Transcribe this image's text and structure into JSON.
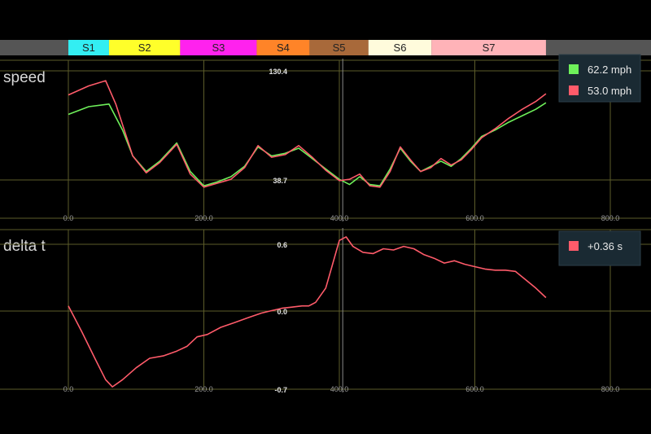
{
  "sectors": [
    {
      "label": "S1",
      "color": "#33eef2",
      "from": 0,
      "to": 60
    },
    {
      "label": "S2",
      "color": "#ffff2a",
      "from": 60,
      "to": 165
    },
    {
      "label": "S3",
      "color": "#ff22ee",
      "from": 165,
      "to": 278
    },
    {
      "label": "S4",
      "color": "#ff8428",
      "from": 278,
      "to": 356
    },
    {
      "label": "S5",
      "color": "#a8693a",
      "from": 356,
      "to": 443
    },
    {
      "label": "S6",
      "color": "#fffbdc",
      "from": 443,
      "to": 536
    },
    {
      "label": "S7",
      "color": "#ffb3b8",
      "from": 536,
      "to": 705
    }
  ],
  "colors": {
    "lap_a": "#6ef05a",
    "lap_b": "#ff5b6a",
    "grid": "#5c5c2a",
    "cursor": "#8a8a8a",
    "sector_bar_bg": "#555555",
    "legend_bg": "#1a2a33"
  },
  "chart_data": [
    {
      "type": "line",
      "title": "speed",
      "xlim": [
        0,
        800
      ],
      "x_ticks": [
        "0.0",
        "200.0",
        "400.0",
        "600.0",
        "800.0"
      ],
      "y_labels": [
        "130.4",
        "38.7"
      ],
      "ylim": [
        22,
        140
      ],
      "cursor_x": 405,
      "grid": true,
      "legend_position": "top-right",
      "series": [
        {
          "name": "62.2 mph",
          "color": "#6ef05a",
          "x": [
            0,
            30,
            60,
            80,
            95,
            115,
            135,
            160,
            180,
            200,
            220,
            240,
            260,
            280,
            300,
            320,
            340,
            360,
            380,
            400,
            415,
            430,
            445,
            460,
            475,
            490,
            505,
            520,
            535,
            550,
            565,
            580,
            595,
            610,
            630,
            650,
            670,
            690,
            705
          ],
          "y": [
            102,
            108,
            110,
            90,
            70,
            58,
            66,
            80,
            58,
            47,
            50,
            54,
            62,
            77,
            70,
            72,
            76,
            68,
            60,
            52,
            48,
            54,
            48,
            47,
            60,
            76,
            66,
            58,
            62,
            66,
            62,
            68,
            76,
            85,
            90,
            96,
            101,
            106,
            111
          ]
        },
        {
          "name": "53.0 mph",
          "color": "#ff5b6a",
          "x": [
            0,
            30,
            55,
            70,
            95,
            115,
            135,
            160,
            180,
            200,
            220,
            240,
            260,
            280,
            300,
            320,
            340,
            360,
            380,
            400,
            415,
            430,
            445,
            460,
            475,
            490,
            505,
            520,
            535,
            550,
            565,
            580,
            595,
            610,
            630,
            650,
            670,
            690,
            705
          ],
          "y": [
            117,
            124,
            128,
            110,
            70,
            57,
            65,
            79,
            56,
            46,
            49,
            52,
            61,
            78,
            69,
            71,
            78,
            69,
            59,
            51,
            52,
            56,
            47,
            46,
            58,
            77,
            67,
            58,
            61,
            68,
            63,
            67,
            75,
            84,
            91,
            99,
            106,
            112,
            118
          ]
        }
      ]
    },
    {
      "type": "line",
      "title": "delta t",
      "xlim": [
        0,
        800
      ],
      "x_ticks": [
        "0.0",
        "200.0",
        "400.0",
        "600.0",
        "800.0"
      ],
      "y_labels": [
        "0.6",
        "0.0",
        "-0.7"
      ],
      "ylim": [
        -0.7,
        0.6
      ],
      "cursor_x": 405,
      "grid": true,
      "legend_position": "top-right",
      "series": [
        {
          "name": "+0.36 s",
          "color": "#ff5b6a",
          "x": [
            0,
            20,
            40,
            55,
            65,
            80,
            100,
            120,
            140,
            160,
            175,
            190,
            205,
            225,
            245,
            265,
            285,
            300,
            315,
            330,
            345,
            355,
            365,
            380,
            390,
            400,
            410,
            420,
            435,
            450,
            465,
            480,
            495,
            510,
            525,
            540,
            555,
            570,
            585,
            600,
            615,
            630,
            645,
            660,
            675,
            690,
            705
          ],
          "y": [
            0.0,
            -0.22,
            -0.45,
            -0.62,
            -0.68,
            -0.62,
            -0.52,
            -0.44,
            -0.42,
            -0.38,
            -0.34,
            -0.26,
            -0.24,
            -0.18,
            -0.14,
            -0.1,
            -0.06,
            -0.04,
            -0.02,
            -0.01,
            0.0,
            0.0,
            0.03,
            0.15,
            0.35,
            0.55,
            0.58,
            0.5,
            0.45,
            0.44,
            0.48,
            0.47,
            0.5,
            0.48,
            0.43,
            0.4,
            0.36,
            0.38,
            0.35,
            0.33,
            0.31,
            0.3,
            0.3,
            0.29,
            0.22,
            0.15,
            0.07
          ]
        }
      ]
    }
  ]
}
